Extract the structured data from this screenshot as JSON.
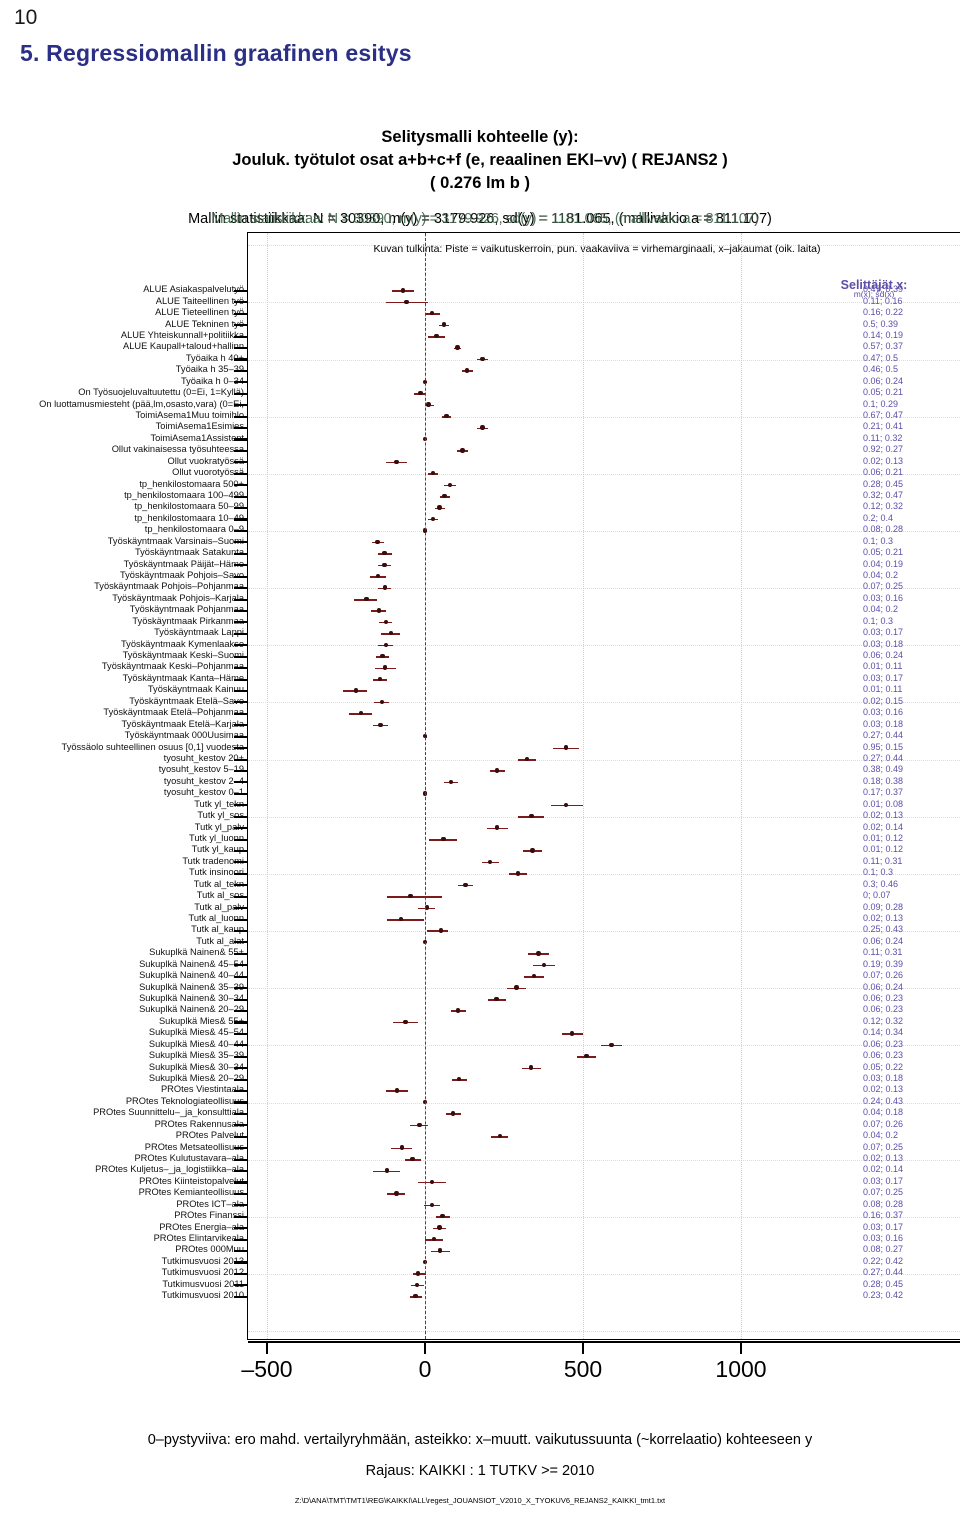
{
  "page_number": "10",
  "slide_title": "5. Regressiomallin graafinen esitys",
  "chart_title": {
    "line1": "Selitysmalli kohteelle (y):",
    "line2": "Jouluk. työtulot osat a+b+c+f (e, reaalinen EKI–vv) ( REJANS2 )",
    "line3": "( 0.276 lm b )"
  },
  "stats_line": "Mallin statistiikkaa: N = 30390, m(y) = 3179.926, sd(y) = 1181.065, (mallivakio a = 811.107)",
  "stats_overlay": "Mallin statistiikkaa: N = 30390, m(y) = 3179.926, sd(y) = 1181.065, (mallivakio a = 811.107)",
  "interpretation_note": "Kuvan tulkinta: Piste = vaikutuskerroin, pun. vaakaviiva = virhemarginaali, x–jakaumat (oik. laita)",
  "legend": {
    "header": "Selittäjät x:",
    "subheader": "m(x); sd(x)"
  },
  "footer": {
    "line1": "0–pystyviiva: ero mahd. vertailyryhmään, asteikko: x–muutt. vaikutussuunta (~korrelaatio) kohteeseen y",
    "line2": "Rajaus: KAIKKI : 1  TUTKV >= 2010",
    "line3": "Z:\\D\\ANA\\TMT\\TMT1\\REG\\KAIKKI\\ALL\\regest_JOUANSIOT_V2010_X_TYOKUV6_REJANS2_KAIKKI_tmt1.txt"
  },
  "colors": {
    "title": "#2b2f86",
    "bar": "#7d1b1b",
    "point": "#3a0c0c",
    "zero_line": "#9e2020",
    "stat_text": "#5b4fa8"
  },
  "chart_data": {
    "type": "scatter",
    "title": "Selitysmalli kohteelle (y): Jouluk. työtulot osat a+b+c+f (e, reaalinen EKI–vv) ( REJANS2 ) ( 0.276 lm b )",
    "xlabel": "",
    "ylabel": "",
    "xlim": [
      -640,
      1055
    ],
    "xticks": [
      -500,
      0,
      500,
      1000
    ],
    "xticklabels": [
      "–500",
      "0",
      "500",
      "1000"
    ],
    "grid": true,
    "legend_position": "right",
    "value_column_header": "m(x); sd(x)",
    "rows": [
      {
        "label": "ALUE Asiakaspalvelutyö",
        "coef": -70,
        "lo": -105,
        "hi": -35,
        "mx": "0.47",
        "sd": "0.39",
        "stat": "0.47; 0.39"
      },
      {
        "label": "ALUE Taiteellinen työ",
        "coef": -58,
        "lo": -125,
        "hi": 10,
        "mx": "0.11",
        "sd": "0.16",
        "stat": "0.11; 0.16"
      },
      {
        "label": "ALUE Tieteellinen työ",
        "coef": 23,
        "lo": 0,
        "hi": 47,
        "mx": "0.16",
        "sd": "0.22",
        "stat": "0.16; 0.22"
      },
      {
        "label": "ALUE Tekninen työ",
        "coef": 60,
        "lo": 45,
        "hi": 75,
        "mx": "0.5",
        "sd": "0.39",
        "stat": "0.5; 0.39"
      },
      {
        "label": "ALUE Yhteiskunnall+politiikka",
        "coef": 36,
        "lo": 8,
        "hi": 63,
        "mx": "0.14",
        "sd": "0.19",
        "stat": "0.14; 0.19"
      },
      {
        "label": "ALUE Kaupall+taloud+hallinn",
        "coef": 103,
        "lo": 93,
        "hi": 115,
        "mx": "0.57",
        "sd": "0.37",
        "stat": "0.57; 0.37"
      },
      {
        "label": "Työaika h 40+",
        "coef": 182,
        "lo": 163,
        "hi": 199,
        "mx": "0.47",
        "sd": "0.5",
        "stat": "0.47; 0.5"
      },
      {
        "label": "Työaika h 35–39",
        "coef": 133,
        "lo": 117,
        "hi": 152,
        "mx": "0.46",
        "sd": "0.5",
        "stat": "0.46; 0.5"
      },
      {
        "label": "Työaika h 0–34",
        "coef": 0,
        "lo": 0,
        "hi": 0,
        "mx": "0.06",
        "sd": "0.24",
        "stat": "0.06; 0.24"
      },
      {
        "label": "On Työsuojeluvaltuutettu (0=Ei, 1=Kyllä)",
        "coef": -14,
        "lo": -34,
        "hi": 4,
        "mx": "0.05",
        "sd": "0.21",
        "stat": "0.05; 0.21"
      },
      {
        "label": "On luottamusmiesteht  (pää,lm,osasto,vara) (0=Ei,",
        "coef": 11,
        "lo": 0,
        "hi": 27,
        "mx": "0.1",
        "sd": "0.29",
        "stat": "0.1; 0.29"
      },
      {
        "label": "ToimiAsema1Muu toimihlo",
        "coef": 68,
        "lo": 54,
        "hi": 83,
        "mx": "0.67",
        "sd": "0.47",
        "stat": "0.67; 0.47"
      },
      {
        "label": "ToimiAsema1Esimies",
        "coef": 182,
        "lo": 163,
        "hi": 199,
        "mx": "0.21",
        "sd": "0.41",
        "stat": "0.21; 0.41"
      },
      {
        "label": "ToimiAsema1Assistent",
        "coef": 0,
        "lo": 0,
        "hi": 0,
        "mx": "0.11",
        "sd": "0.32",
        "stat": "0.11; 0.32"
      },
      {
        "label": "Ollut vakinaisessa työsuhteessa",
        "coef": 119,
        "lo": 102,
        "hi": 135,
        "mx": "0.92",
        "sd": "0.27",
        "stat": "0.92; 0.27"
      },
      {
        "label": "Ollut vuokratyössä",
        "coef": -90,
        "lo": -124,
        "hi": -56,
        "mx": "0.02",
        "sd": "0.13",
        "stat": "0.02; 0.13"
      },
      {
        "label": "Ollut vuorotyössä",
        "coef": 26,
        "lo": 9,
        "hi": 42,
        "mx": "0.06",
        "sd": "0.21",
        "stat": "0.06; 0.21"
      },
      {
        "label": "tp_henkilostomaara 500+",
        "coef": 79,
        "lo": 61,
        "hi": 97,
        "mx": "0.28",
        "sd": "0.45",
        "stat": "0.28; 0.45"
      },
      {
        "label": "tp_henkilostomaara 100–499",
        "coef": 62,
        "lo": 48,
        "hi": 78,
        "mx": "0.32",
        "sd": "0.47",
        "stat": "0.32; 0.47"
      },
      {
        "label": "tp_henkilostomaara 50–99",
        "coef": 46,
        "lo": 31,
        "hi": 63,
        "mx": "0.12",
        "sd": "0.32",
        "stat": "0.12; 0.32"
      },
      {
        "label": "tp_henkilostomaara 10–49",
        "coef": 26,
        "lo": 10,
        "hi": 41,
        "mx": "0.2",
        "sd": "0.4",
        "stat": "0.2; 0.4"
      },
      {
        "label": "tp_henkilostomaara 0–9",
        "coef": 0,
        "lo": 0,
        "hi": 0,
        "mx": "0.08",
        "sd": "0.28",
        "stat": "0.08; 0.28"
      },
      {
        "label": "Työskäyntmaak  Varsinais–Suomi",
        "coef": -150,
        "lo": -168,
        "hi": -131,
        "mx": "0.1",
        "sd": "0.3",
        "stat": "0.1; 0.3"
      },
      {
        "label": "Työskäyntmaak  Satakunta",
        "coef": -128,
        "lo": -150,
        "hi": -105,
        "mx": "0.05",
        "sd": "0.21",
        "stat": "0.05; 0.21"
      },
      {
        "label": "Työskäyntmaak  Päijät–Häme",
        "coef": -128,
        "lo": -150,
        "hi": -106,
        "mx": "0.04",
        "sd": "0.19",
        "stat": "0.04; 0.19"
      },
      {
        "label": "Työskäyntmaak  Pohjois–Savo",
        "coef": -149,
        "lo": -175,
        "hi": -124,
        "mx": "0.04",
        "sd": "0.2",
        "stat": "0.04; 0.2"
      },
      {
        "label": "Työskäyntmaak  Pohjois–Pohjanmaa",
        "coef": -126,
        "lo": -150,
        "hi": -106,
        "mx": "0.07",
        "sd": "0.25",
        "stat": "0.07; 0.25"
      },
      {
        "label": "Työskäyntmaak  Pohjois–Karjala",
        "coef": -185,
        "lo": -225,
        "hi": -152,
        "mx": "0.03",
        "sd": "0.16",
        "stat": "0.03; 0.16"
      },
      {
        "label": "Työskäyntmaak  Pohjanmaa",
        "coef": -146,
        "lo": -170,
        "hi": -123,
        "mx": "0.04",
        "sd": "0.2",
        "stat": "0.04; 0.2"
      },
      {
        "label": "Työskäyntmaak  Pirkanmaa",
        "coef": -124,
        "lo": -145,
        "hi": -105,
        "mx": "0.1",
        "sd": "0.3",
        "stat": "0.1; 0.3"
      },
      {
        "label": "Työskäyntmaak  Lappi",
        "coef": -108,
        "lo": -140,
        "hi": -78,
        "mx": "0.03",
        "sd": "0.17",
        "stat": "0.03; 0.17"
      },
      {
        "label": "Työskäyntmaak  Kymenlaakso",
        "coef": -124,
        "lo": -148,
        "hi": -100,
        "mx": "0.03",
        "sd": "0.18",
        "stat": "0.03; 0.18"
      },
      {
        "label": "Työskäyntmaak  Keski–Suomi",
        "coef": -134,
        "lo": -155,
        "hi": -113,
        "mx": "0.06",
        "sd": "0.24",
        "stat": "0.06; 0.24"
      },
      {
        "label": "Työskäyntmaak  Keski–Pohjanmaa",
        "coef": -126,
        "lo": -159,
        "hi": -91,
        "mx": "0.01",
        "sd": "0.11",
        "stat": "0.01; 0.11"
      },
      {
        "label": "Työskäyntmaak  Kanta–Häme",
        "coef": -142,
        "lo": -163,
        "hi": -121,
        "mx": "0.03",
        "sd": "0.17",
        "stat": "0.03; 0.17"
      },
      {
        "label": "Työskäyntmaak  Kainuu",
        "coef": -219,
        "lo": -258,
        "hi": -183,
        "mx": "0.01",
        "sd": "0.11",
        "stat": "0.01; 0.11"
      },
      {
        "label": "Työskäyntmaak  Etelä–Savo",
        "coef": -137,
        "lo": -160,
        "hi": -113,
        "mx": "0.02",
        "sd": "0.15",
        "stat": "0.02; 0.15"
      },
      {
        "label": "Työskäyntmaak  Etelä–Pohjanmaa",
        "coef": -203,
        "lo": -239,
        "hi": -169,
        "mx": "0.03",
        "sd": "0.16",
        "stat": "0.03; 0.16"
      },
      {
        "label": "Työskäyntmaak  Etelä–Karjala",
        "coef": -141,
        "lo": -163,
        "hi": -118,
        "mx": "0.03",
        "sd": "0.18",
        "stat": "0.03; 0.18"
      },
      {
        "label": "Työskäyntmaak  000Uusimaa",
        "coef": 0,
        "lo": 0,
        "hi": 0,
        "mx": "0.27",
        "sd": "0.44",
        "stat": "0.27; 0.44"
      },
      {
        "label": "Työssäolo suhteellinen osuus [0,1] vuodesta",
        "coef": 447,
        "lo": 406,
        "hi": 486,
        "mx": "0.95",
        "sd": "0.15",
        "stat": "0.95; 0.15"
      },
      {
        "label": "tyosuht_kestov 20+",
        "coef": 322,
        "lo": 294,
        "hi": 350,
        "mx": "0.27",
        "sd": "0.44",
        "stat": "0.27; 0.44"
      },
      {
        "label": "tyosuht_kestov 5–19",
        "coef": 228,
        "lo": 205,
        "hi": 252,
        "mx": "0.38",
        "sd": "0.49",
        "stat": "0.38; 0.49"
      },
      {
        "label": "tyosuht_kestov 2–4",
        "coef": 82,
        "lo": 60,
        "hi": 103,
        "mx": "0.18",
        "sd": "0.38",
        "stat": "0.18; 0.38"
      },
      {
        "label": "tyosuht_kestov 0–1",
        "coef": 0,
        "lo": 0,
        "hi": 0,
        "mx": "0.17",
        "sd": "0.37",
        "stat": "0.17; 0.37"
      },
      {
        "label": "Tutk yl_tekn",
        "coef": 446,
        "lo": 400,
        "hi": 499,
        "mx": "0.01",
        "sd": "0.08",
        "stat": "0.01; 0.08"
      },
      {
        "label": "Tutk yl_sos",
        "coef": 337,
        "lo": 295,
        "hi": 378,
        "mx": "0.02",
        "sd": "0.13",
        "stat": "0.02; 0.13"
      },
      {
        "label": "Tutk yl_palv",
        "coef": 228,
        "lo": 195,
        "hi": 263,
        "mx": "0.02",
        "sd": "0.14",
        "stat": "0.02; 0.14"
      },
      {
        "label": "Tutk yl_luonn",
        "coef": 58,
        "lo": 14,
        "hi": 100,
        "mx": "0.01",
        "sd": "0.12",
        "stat": "0.01; 0.12"
      },
      {
        "label": "Tutk yl_kaup",
        "coef": 340,
        "lo": 310,
        "hi": 370,
        "mx": "0.01",
        "sd": "0.12",
        "stat": "0.01; 0.12"
      },
      {
        "label": "Tutk tradenomi",
        "coef": 206,
        "lo": 180,
        "hi": 235,
        "mx": "0.11",
        "sd": "0.31",
        "stat": "0.11; 0.31"
      },
      {
        "label": "Tutk insinoori",
        "coef": 294,
        "lo": 267,
        "hi": 323,
        "mx": "0.1",
        "sd": "0.3",
        "stat": "0.1; 0.3"
      },
      {
        "label": "Tutk al_tekn",
        "coef": 128,
        "lo": 103,
        "hi": 152,
        "mx": "0.3",
        "sd": "0.46",
        "stat": "0.3; 0.46"
      },
      {
        "label": "Tutk al_sos",
        "coef": -46,
        "lo": -120,
        "hi": 53,
        "mx": "0",
        "sd": "0.07",
        "stat": "0; 0.07"
      },
      {
        "label": "Tutk al_palv",
        "coef": 7,
        "lo": -22,
        "hi": 32,
        "mx": "0.09",
        "sd": "0.28",
        "stat": "0.09; 0.28"
      },
      {
        "label": "Tutk al_luonn",
        "coef": -75,
        "lo": -120,
        "hi": -2,
        "mx": "0.02",
        "sd": "0.13",
        "stat": "0.02; 0.13"
      },
      {
        "label": "Tutk al_kaup",
        "coef": 50,
        "lo": 7,
        "hi": 72,
        "mx": "0.25",
        "sd": "0.43",
        "stat": "0.25; 0.43"
      },
      {
        "label": "Tutk al_alat",
        "coef": 0,
        "lo": 0,
        "hi": 0,
        "mx": "0.06",
        "sd": "0.24",
        "stat": "0.06; 0.24"
      },
      {
        "label": "Sukuplkä Nainen& 55+",
        "coef": 359,
        "lo": 327,
        "hi": 392,
        "mx": "0.11",
        "sd": "0.31",
        "stat": "0.11; 0.31"
      },
      {
        "label": "Sukuplkä Nainen& 45–54",
        "coef": 376,
        "lo": 343,
        "hi": 411,
        "mx": "0.19",
        "sd": "0.39",
        "stat": "0.19; 0.39"
      },
      {
        "label": "Sukuplkä Nainen& 40–44",
        "coef": 345,
        "lo": 314,
        "hi": 376,
        "mx": "0.07",
        "sd": "0.26",
        "stat": "0.07; 0.26"
      },
      {
        "label": "Sukuplkä Nainen& 35–39",
        "coef": 290,
        "lo": 258,
        "hi": 320,
        "mx": "0.06",
        "sd": "0.24",
        "stat": "0.06; 0.24"
      },
      {
        "label": "Sukuplkä Nainen& 30–34",
        "coef": 226,
        "lo": 199,
        "hi": 255,
        "mx": "0.06",
        "sd": "0.23",
        "stat": "0.06; 0.23"
      },
      {
        "label": "Sukuplkä Nainen& 20–29",
        "coef": 105,
        "lo": 81,
        "hi": 130,
        "mx": "0.06",
        "sd": "0.23",
        "stat": "0.06; 0.23"
      },
      {
        "label": "Sukuplkä Mies& 55+",
        "coef": -62,
        "lo": -100,
        "hi": -22,
        "mx": "0.12",
        "sd": "0.32",
        "stat": "0.12; 0.32"
      },
      {
        "label": "Sukuplkä Mies& 45–54",
        "coef": 466,
        "lo": 433,
        "hi": 500,
        "mx": "0.14",
        "sd": "0.34",
        "stat": "0.14; 0.34"
      },
      {
        "label": "Sukuplkä Mies& 40–44",
        "coef": 590,
        "lo": 558,
        "hi": 625,
        "mx": "0.06",
        "sd": "0.23",
        "stat": "0.06; 0.23"
      },
      {
        "label": "Sukuplkä Mies& 35–39",
        "coef": 511,
        "lo": 481,
        "hi": 541,
        "mx": "0.06",
        "sd": "0.23",
        "stat": "0.06; 0.23"
      },
      {
        "label": "Sukuplkä Mies& 30–34",
        "coef": 336,
        "lo": 306,
        "hi": 368,
        "mx": "0.05",
        "sd": "0.22",
        "stat": "0.05; 0.22"
      },
      {
        "label": "Sukuplkä Mies& 20–29",
        "coef": 108,
        "lo": 85,
        "hi": 133,
        "mx": "0.03",
        "sd": "0.18",
        "stat": "0.03; 0.18"
      },
      {
        "label": "PROtes Viestintaala",
        "coef": -88,
        "lo": -125,
        "hi": -53,
        "mx": "0.02",
        "sd": "0.13",
        "stat": "0.02; 0.13"
      },
      {
        "label": "PROtes Teknologiateollisuus",
        "coef": 0,
        "lo": 0,
        "hi": 0,
        "mx": "0.24",
        "sd": "0.43",
        "stat": "0.24; 0.43"
      },
      {
        "label": "PROtes Suunnittelu–_ja_konsulttiala",
        "coef": 89,
        "lo": 66,
        "hi": 113,
        "mx": "0.04",
        "sd": "0.18",
        "stat": "0.04; 0.18"
      },
      {
        "label": "PROtes Rakennusala",
        "coef": -18,
        "lo": -48,
        "hi": 10,
        "mx": "0.07",
        "sd": "0.26",
        "stat": "0.07; 0.26"
      },
      {
        "label": "PROtes Palvelut",
        "coef": 237,
        "lo": 210,
        "hi": 263,
        "mx": "0.04",
        "sd": "0.2",
        "stat": "0.04; 0.2"
      },
      {
        "label": "PROtes Metsateollisuus",
        "coef": -73,
        "lo": -107,
        "hi": -40,
        "mx": "0.07",
        "sd": "0.25",
        "stat": "0.07; 0.25"
      },
      {
        "label": "PROtes Kulutustavara–ala",
        "coef": -40,
        "lo": -62,
        "hi": -14,
        "mx": "0.02",
        "sd": "0.13",
        "stat": "0.02; 0.13"
      },
      {
        "label": "PROtes Kuljetus–_ja_logistiikka–ala",
        "coef": -120,
        "lo": -163,
        "hi": -80,
        "mx": "0.02",
        "sd": "0.14",
        "stat": "0.02; 0.14"
      },
      {
        "label": "PROtes Kiinteistopalvelut",
        "coef": 22,
        "lo": -22,
        "hi": 65,
        "mx": "0.03",
        "sd": "0.17",
        "stat": "0.03; 0.17"
      },
      {
        "label": "PROtes Kemianteollisuus",
        "coef": -90,
        "lo": -120,
        "hi": -62,
        "mx": "0.07",
        "sd": "0.25",
        "stat": "0.07; 0.25"
      },
      {
        "label": "PROtes ICT–ala",
        "coef": 22,
        "lo": -3,
        "hi": 48,
        "mx": "0.08",
        "sd": "0.28",
        "stat": "0.08; 0.28"
      },
      {
        "label": "PROtes Finanssi",
        "coef": 56,
        "lo": 35,
        "hi": 80,
        "mx": "0.16",
        "sd": "0.37",
        "stat": "0.16; 0.37"
      },
      {
        "label": "PROtes Energia–ala",
        "coef": 46,
        "lo": 26,
        "hi": 68,
        "mx": "0.03",
        "sd": "0.17",
        "stat": "0.03; 0.17"
      },
      {
        "label": "PROtes Elintarvikeala",
        "coef": 28,
        "lo": 0,
        "hi": 56,
        "mx": "0.03",
        "sd": "0.16",
        "stat": "0.03; 0.16"
      },
      {
        "label": "PROtes 000Muu",
        "coef": 48,
        "lo": 18,
        "hi": 78,
        "mx": "0.08",
        "sd": "0.27",
        "stat": "0.08; 0.27"
      },
      {
        "label": "Tutkimusvuosi  2013",
        "coef": 0,
        "lo": 0,
        "hi": 0,
        "mx": "0.22",
        "sd": "0.42",
        "stat": "0.22; 0.42"
      },
      {
        "label": "Tutkimusvuosi  2012",
        "coef": -22,
        "lo": -38,
        "hi": 3,
        "mx": "0.27",
        "sd": "0.44",
        "stat": "0.27; 0.44"
      },
      {
        "label": "Tutkimusvuosi  2011",
        "coef": -26,
        "lo": -45,
        "hi": -4,
        "mx": "0.28",
        "sd": "0.45",
        "stat": "0.28; 0.45"
      },
      {
        "label": "Tutkimusvuosi  2010",
        "coef": -30,
        "lo": -48,
        "hi": -8,
        "mx": "0.23",
        "sd": "0.42",
        "stat": "0.23; 0.42"
      }
    ]
  }
}
